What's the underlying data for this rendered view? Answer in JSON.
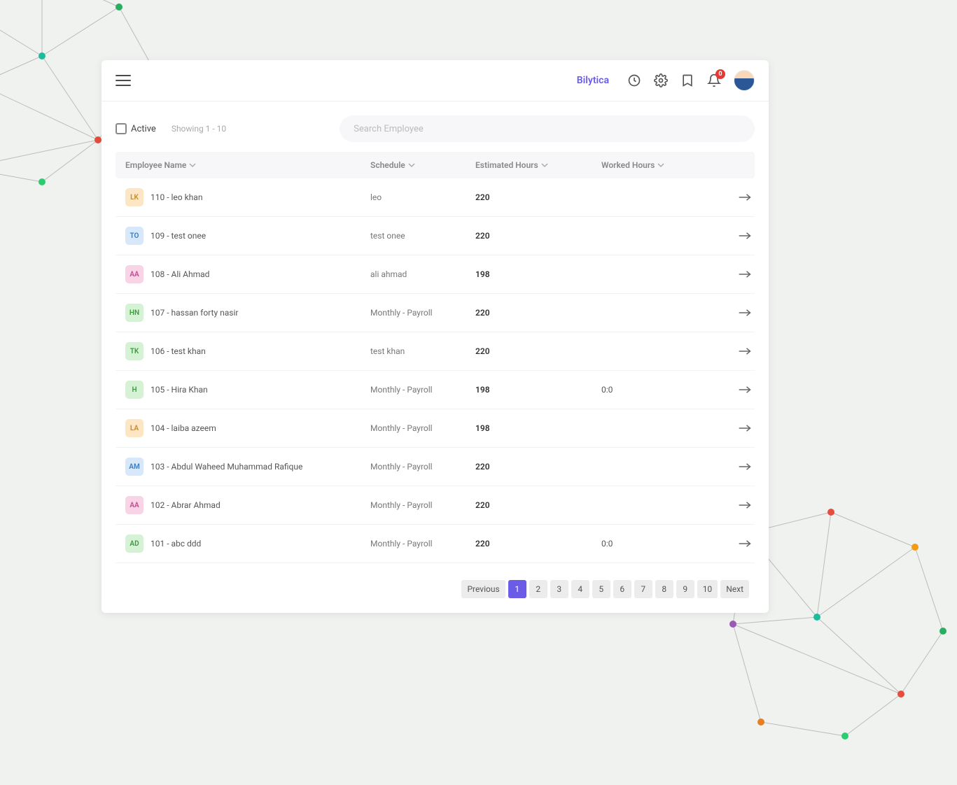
{
  "header": {
    "brand": "Bilytica",
    "notif_count": "0"
  },
  "filter": {
    "active_label": "Active",
    "showing": "Showing 1 - 10",
    "search_placeholder": "Search Employee"
  },
  "columns": {
    "name": "Employee Name",
    "schedule": "Schedule",
    "estimated": "Estimated Hours",
    "worked": "Worked Hours"
  },
  "rows": [
    {
      "initials": "LK",
      "bg": "#fde6c4",
      "fg": "#c68a2f",
      "name": "110 - leo khan",
      "schedule": "leo",
      "estimated": "220",
      "worked": ""
    },
    {
      "initials": "TO",
      "bg": "#d6e8f9",
      "fg": "#3a7bc1",
      "name": "109 - test onee",
      "schedule": "test onee",
      "estimated": "220",
      "worked": ""
    },
    {
      "initials": "AA",
      "bg": "#f9d3e6",
      "fg": "#c24b8e",
      "name": "108 - Ali Ahmad",
      "schedule": "ali ahmad",
      "estimated": "198",
      "worked": ""
    },
    {
      "initials": "HN",
      "bg": "#d5f2d5",
      "fg": "#3b9b3b",
      "name": "107 - hassan forty nasir",
      "schedule": "Monthly - Payroll",
      "estimated": "220",
      "worked": ""
    },
    {
      "initials": "TK",
      "bg": "#d5f2d5",
      "fg": "#3b9b3b",
      "name": "106 - test khan",
      "schedule": "test khan",
      "estimated": "220",
      "worked": ""
    },
    {
      "initials": "H",
      "bg": "#d5f2d5",
      "fg": "#3b9b3b",
      "name": "105 - Hira Khan",
      "schedule": "Monthly - Payroll",
      "estimated": "198",
      "worked": "0:0"
    },
    {
      "initials": "LA",
      "bg": "#fde6c4",
      "fg": "#c68a2f",
      "name": "104 - laiba azeem",
      "schedule": "Monthly - Payroll",
      "estimated": "198",
      "worked": ""
    },
    {
      "initials": "AM",
      "bg": "#d6e8f9",
      "fg": "#3a7bc1",
      "name": "103 - Abdul Waheed Muhammad Rafique",
      "schedule": "Monthly - Payroll",
      "estimated": "220",
      "worked": ""
    },
    {
      "initials": "AA",
      "bg": "#f9d3e6",
      "fg": "#c24b8e",
      "name": "102 - Abrar Ahmad",
      "schedule": "Monthly - Payroll",
      "estimated": "220",
      "worked": ""
    },
    {
      "initials": "AD",
      "bg": "#d5f2d5",
      "fg": "#3b9b3b",
      "name": "101 - abc ddd",
      "schedule": "Monthly - Payroll",
      "estimated": "220",
      "worked": "0:0"
    }
  ],
  "pagination": {
    "prev": "Previous",
    "next": "Next",
    "pages": [
      "1",
      "2",
      "3",
      "4",
      "5",
      "6",
      "7",
      "8",
      "9",
      "10"
    ],
    "active": "1"
  }
}
